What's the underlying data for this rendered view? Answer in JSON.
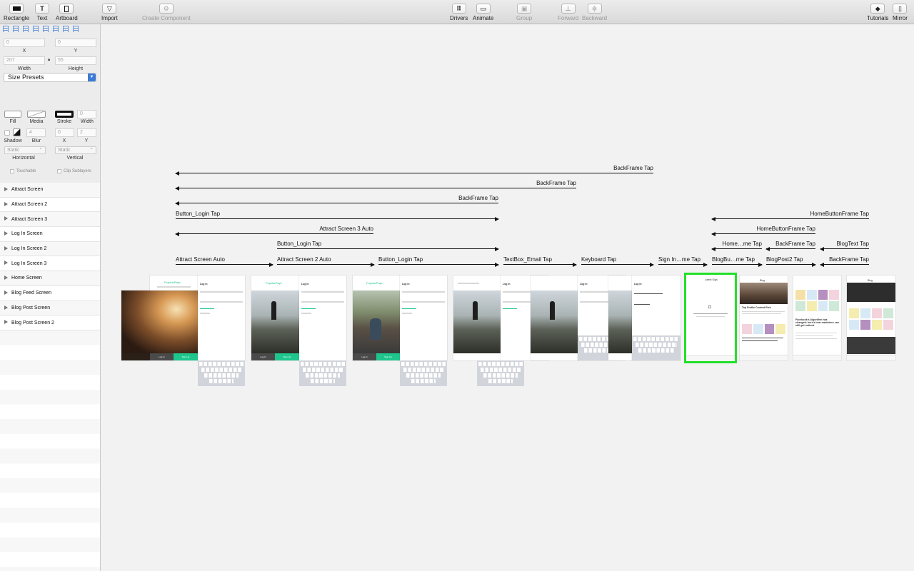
{
  "toolbar": {
    "rectangle": "Rectangle",
    "text": "Text",
    "artboard": "Artboard",
    "import": "Import",
    "create_component": "Create Component",
    "drivers": "Drivers",
    "animate": "Animate",
    "group": "Group",
    "forward": "Forward",
    "backward": "Backward",
    "tutorials": "Tutorials",
    "mirror": "Mirror"
  },
  "inspector": {
    "x_value": "0",
    "x_label": "X",
    "y_value": "0",
    "y_label": "Y",
    "width_value": "207",
    "width_label": "Width",
    "height_value": "55",
    "height_label": "Height",
    "size_presets": "Size Presets",
    "fill_label": "Fill",
    "media_label": "Media",
    "stroke_label": "Stroke",
    "stroke_width_value": "0",
    "stroke_width_label": "Width",
    "shadow_label": "Shadow",
    "blur_value": "4",
    "blur_label": "Blur",
    "shadow_x_value": "0",
    "shadow_x_label": "X",
    "shadow_y_value": "2",
    "shadow_y_label": "Y",
    "horizontal_value": "Static",
    "horizontal_label": "Horizontal",
    "vertical_value": "Static",
    "vertical_label": "Vertical",
    "touchable": "Touchable",
    "clip_sublayers": "Clip Sublayers"
  },
  "layers": [
    "Attract Screen",
    "Attract Screen 2",
    "Attract Screen 3",
    "Log In Screen",
    "Log In Screen  2",
    "Log In Screen  3",
    "Home Screen",
    "Blog Feed Screen",
    "Blog Post Screen",
    "Blog Post Screen 2"
  ],
  "connections": [
    "BackFrame Tap",
    "BackFrame Tap",
    "BackFrame Tap",
    "Button_Login Tap",
    "Attract Screen 3 Auto",
    "Button_Login Tap",
    "Attract Screen Auto",
    "Attract Screen 2 Auto",
    "Button_Login Tap",
    "TextBox_Email Tap",
    "Keyboard Tap",
    "Sign In…me Tap",
    "HomeButtonFrame Tap",
    "HomeButtonFrame Tap",
    "Home…me Tap",
    "BackFrame Tap",
    "BlogText Tap",
    "BlogBu…me Tap",
    "BlogPost2 Tap",
    "BackFrame Tap"
  ],
  "screens": {
    "brand": "PopularPays",
    "login_title": "Log In",
    "login_btn": "Log In",
    "signup_btn": "Sign Up",
    "home_title": "Latest Gigs",
    "blog_title": "Blog",
    "blog_post_title": "Top Profile Content Rich",
    "blog_post_headline": "Facebook's Algorithm has changed: here's how marketers can still get noticed"
  },
  "colors": {
    "accent": "#3b7bd6",
    "brand_green": "#1ec68d",
    "selection": "#22e02a"
  }
}
